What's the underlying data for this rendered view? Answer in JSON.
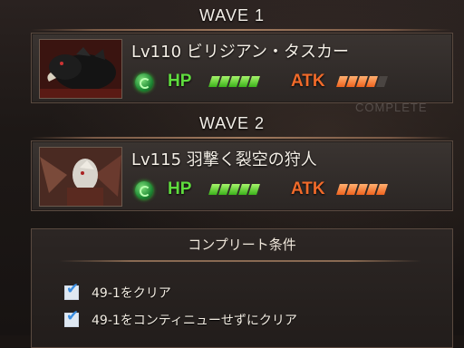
{
  "waves": [
    {
      "label": "WAVE 1",
      "enemy": {
        "name": "Lv110 ビリジアン・タスカー",
        "hp_label": "HP",
        "hp_level": 5,
        "atk_label": "ATK",
        "atk_level": 4,
        "bar_max": 5,
        "portrait": "boar-portrait"
      }
    },
    {
      "label": "WAVE 2",
      "enemy": {
        "name": "Lv115 羽撃く裂空の狩人",
        "hp_label": "HP",
        "hp_level": 5,
        "atk_label": "ATK",
        "atk_level": 5,
        "bar_max": 5,
        "portrait": "winged-hunter-portrait"
      }
    }
  ],
  "background_text": "COMPLETE",
  "conditions": {
    "title": "コンプリート条件",
    "items": [
      {
        "label": "49-1をクリア",
        "checked": true
      },
      {
        "label": "49-1をコンティニューせずにクリア",
        "checked": true
      }
    ]
  },
  "colors": {
    "hp": "#5fdc3e",
    "atk": "#f06a2a",
    "element": "#1f8a35"
  }
}
